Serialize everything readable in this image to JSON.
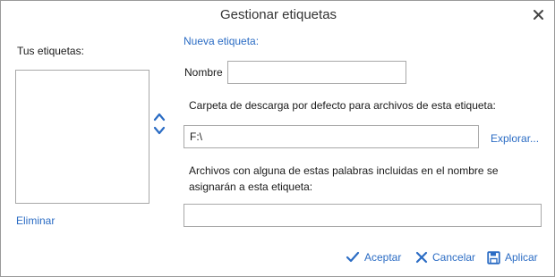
{
  "window": {
    "title": "Gestionar etiquetas",
    "close_icon": "close-icon"
  },
  "left_panel": {
    "label": "Tus etiquetas:",
    "delete_link": "Eliminar"
  },
  "form": {
    "section_title": "Nueva etiqueta:",
    "name_label": "Nombre",
    "name_value": "",
    "folder_label": "Carpeta de descarga por defecto para archivos de esta etiqueta:",
    "folder_value": "F:\\",
    "browse_link": "Explorar...",
    "keywords_label": "Archivos con alguna de estas palabras incluidas en el nombre se asignarán a esta etiqueta:",
    "keywords_value": ""
  },
  "footer": {
    "accept_label": "Aceptar",
    "cancel_label": "Cancelar",
    "apply_label": "Aplicar"
  },
  "colors": {
    "accent": "#2b6cc4",
    "border": "#a8a8a8"
  }
}
